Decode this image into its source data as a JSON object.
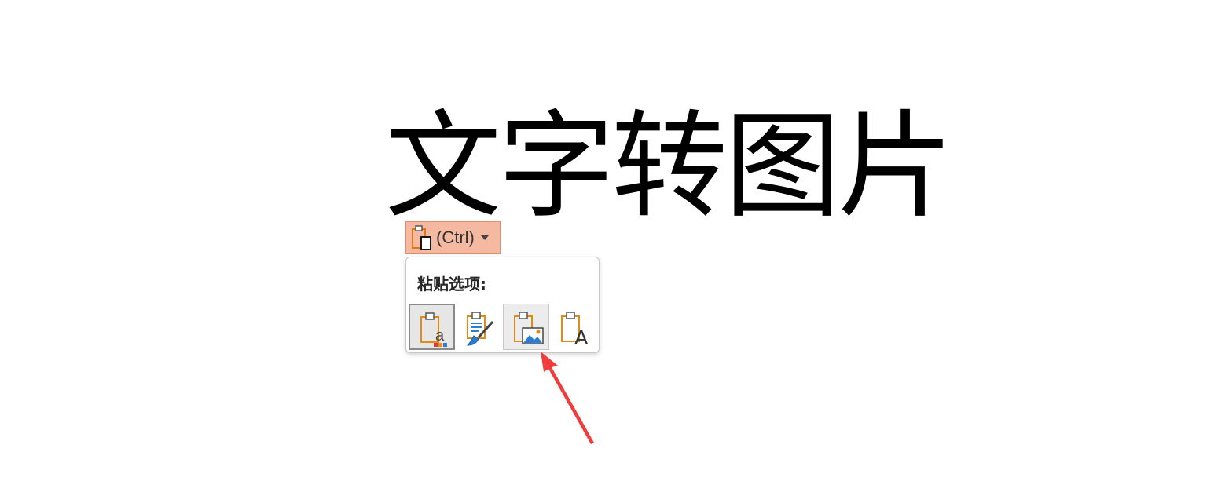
{
  "slide": {
    "title": "文字转图片"
  },
  "paste_control": {
    "label": "(Ctrl)",
    "icon": "clipboard-paste-icon",
    "caret_icon": "dropdown-caret-icon"
  },
  "paste_popup": {
    "heading": "粘贴选项:",
    "options": [
      {
        "icon": "use-destination-theme-icon",
        "state": "selected"
      },
      {
        "icon": "keep-source-formatting-icon",
        "state": "normal"
      },
      {
        "icon": "paste-as-picture-icon",
        "state": "hovered"
      },
      {
        "icon": "keep-text-only-icon",
        "state": "normal"
      }
    ]
  },
  "annotation": {
    "icon": "red-arrow-icon",
    "color": "#f03c3c"
  },
  "colors": {
    "clipboard_orange": "#e88a1a",
    "paste_button_fill": "#f4b9a0",
    "picture_blue": "#2a7fd4"
  }
}
